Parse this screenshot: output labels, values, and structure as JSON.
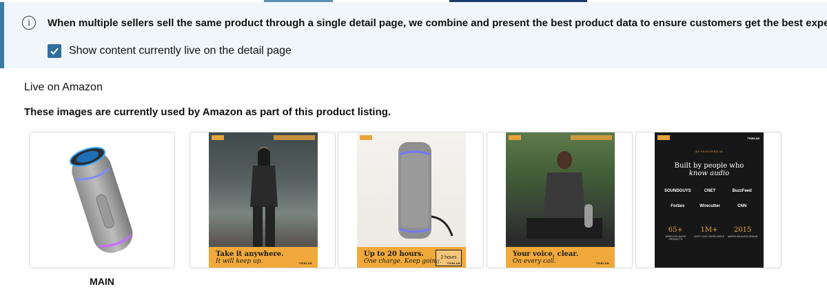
{
  "banner": {
    "info_icon": "info-icon",
    "message": "When multiple sellers sell the same product through a single detail page, we combine and present the best product data to ensure customers get the best experience.",
    "checkbox_checked": true,
    "checkbox_label": "Show content currently live on the detail page"
  },
  "section": {
    "title": "Live on Amazon",
    "description": "These images are currently used by Amazon as part of this product listing."
  },
  "images": [
    {
      "caption": "MAIN"
    },
    {
      "line1": "Take it anywhere.",
      "line2": "It will keep up.",
      "brand": "TRIBLAB"
    },
    {
      "line1": "Up to 20 hours.",
      "line2": "One charge. Keep going.",
      "hours": "2 hours",
      "brand": "TRIBLAB"
    },
    {
      "line1": "Your voice, clear.",
      "line2": "On every call.",
      "brand": "TRIBLAB"
    },
    {
      "featured": "AS FEATURED IN",
      "title": "Built by people who",
      "subtitle": "know audio",
      "brand": "TRIBLAB",
      "logos": [
        "SOUNDGUYS",
        "CNET",
        "BuzzFeed",
        "Forbes",
        "Wirecutter",
        "CNN"
      ],
      "stats": [
        {
          "value": "65+",
          "label": "WIRELESS AUDIO PRODUCTS"
        },
        {
          "value": "1M+",
          "label": "UNITS SOLD WORLDWIDE"
        },
        {
          "value": "2015",
          "label": "AMERICAN AUDIO BRAND"
        }
      ]
    }
  ],
  "colors": {
    "banner_bg": "#f0f6fa",
    "banner_accent": "#3b7aa3",
    "checkbox": "#2f6f9c",
    "strip": "#f0a93a"
  }
}
